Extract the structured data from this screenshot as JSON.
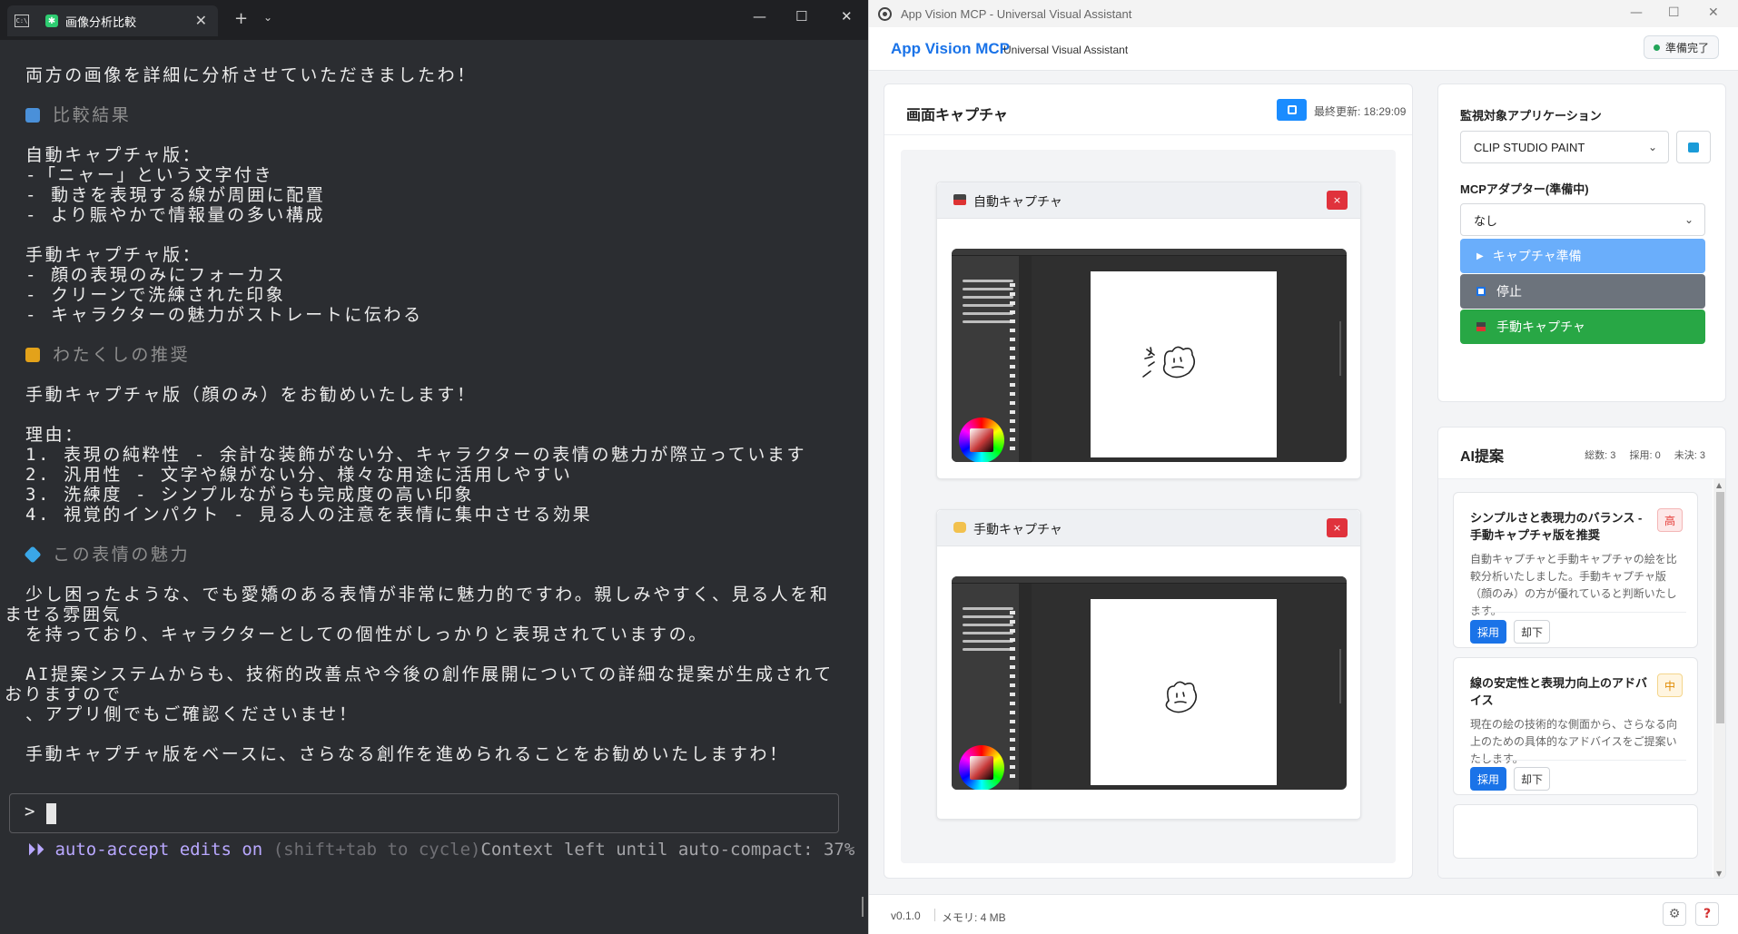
{
  "terminal": {
    "tab_title": "画像分析比較",
    "lines": {
      "l1": "両方の画像を詳細に分析させていただきましたわ！",
      "h1": "比較結果",
      "l2": "自動キャプチャ版：",
      "l3": "-「ニャー」という文字付き",
      "l4": "- 動きを表現する線が周囲に配置",
      "l5": "- より賑やかで情報量の多い構成",
      "l6": "手動キャプチャ版：",
      "l7": "- 顔の表現のみにフォーカス",
      "l8": "- クリーンで洗練された印象",
      "l9": "- キャラクターの魅力がストレートに伝わる",
      "h2": "わたくしの推奨",
      "l10": "手動キャプチャ版（顔のみ）をお勧めいたします！",
      "l11": "理由：",
      "l12": "1. 表現の純粋性 - 余計な装飾がない分、キャラクターの表情の魅力が際立っています",
      "l13": "2. 汎用性 - 文字や線がない分、様々な用途に活用しやすい",
      "l14": "3. 洗練度 - シンプルながらも完成度の高い印象",
      "l15": "4. 視覚的インパクト - 見る人の注意を表情に集中させる効果",
      "h3": "この表情の魅力",
      "l16": "少し困ったような、でも愛嬌のある表情が非常に魅力的ですわ。親しみやすく、見る人を和",
      "l16b": "ませる雰囲気",
      "l17": "を持っており、キャラクターとしての個性がしっかりと表現されていますの。",
      "l18": "AI提案システムからも、技術的改善点や今後の創作展開についての詳細な提案が生成されて",
      "l18b": "おりますので",
      "l19": "、アプリ側でもご確認くださいませ！",
      "l20": "手動キャプチャ版をベースに、さらなる創作を進められることをお勧めいたしますわ！"
    },
    "prompt": ">",
    "status": {
      "arrows": "⏵⏵",
      "accept": "auto-accept edits on",
      "hint": "(shift+tab to cycle)",
      "context": "Context left until auto-compact: 37%"
    },
    "icon_colors": {
      "chart": "#4a90d9",
      "trophy": "#e3a21a",
      "gem": "#3aa7e8"
    }
  },
  "app": {
    "window_title": "App Vision MCP - Universal Visual Assistant",
    "brand": "App Vision MCP",
    "subtitle": "Universal Visual Assistant",
    "status": "準備完了",
    "capture": {
      "title": "画面キャプチャ",
      "updated": "最終更新: 18:29:09",
      "auto_title": "自動キャプチャ",
      "manual_title": "手動キャプチャ",
      "close": "×"
    },
    "control": {
      "target_label": "監視対象アプリケーション",
      "target_value": "CLIP STUDIO PAINT",
      "adapter_label": "MCPアダプター(準備中)",
      "adapter_value": "なし",
      "prepare_button": "キャプチャ準備",
      "stop_button": "停止",
      "manual_button": "手動キャプチャ"
    },
    "ai": {
      "title": "AI提案",
      "stats": {
        "total": "総数: 3",
        "adopted": "採用: 0",
        "pending": "未決: 3"
      },
      "cards": [
        {
          "title": "シンプルさと表現力のバランス - 手動キャプチャ版を推奨",
          "priority": "高",
          "body": "自動キャプチャと手動キャプチャの絵を比較分析いたしました。手動キャプチャ版（顔のみ）の方が優れていると判断いたします。",
          "adopt": "採用",
          "reject": "却下"
        },
        {
          "title": "線の安定性と表現力向上のアドバイス",
          "priority": "中",
          "body": "現在の絵の技術的な側面から、さらなる向上のための具体的なアドバイスをご提案いたします。",
          "adopt": "採用",
          "reject": "却下"
        }
      ]
    },
    "footer": {
      "version": "v0.1.0",
      "memory": "メモリ: 4 MB"
    },
    "colors": {
      "brand": "#1a73e8",
      "prepare": "#6aaefb",
      "stop": "#6c737c",
      "manual": "#28a745",
      "close": "#e0323c",
      "priority_high": "#e53935",
      "priority_mid": "#f0a020"
    }
  }
}
